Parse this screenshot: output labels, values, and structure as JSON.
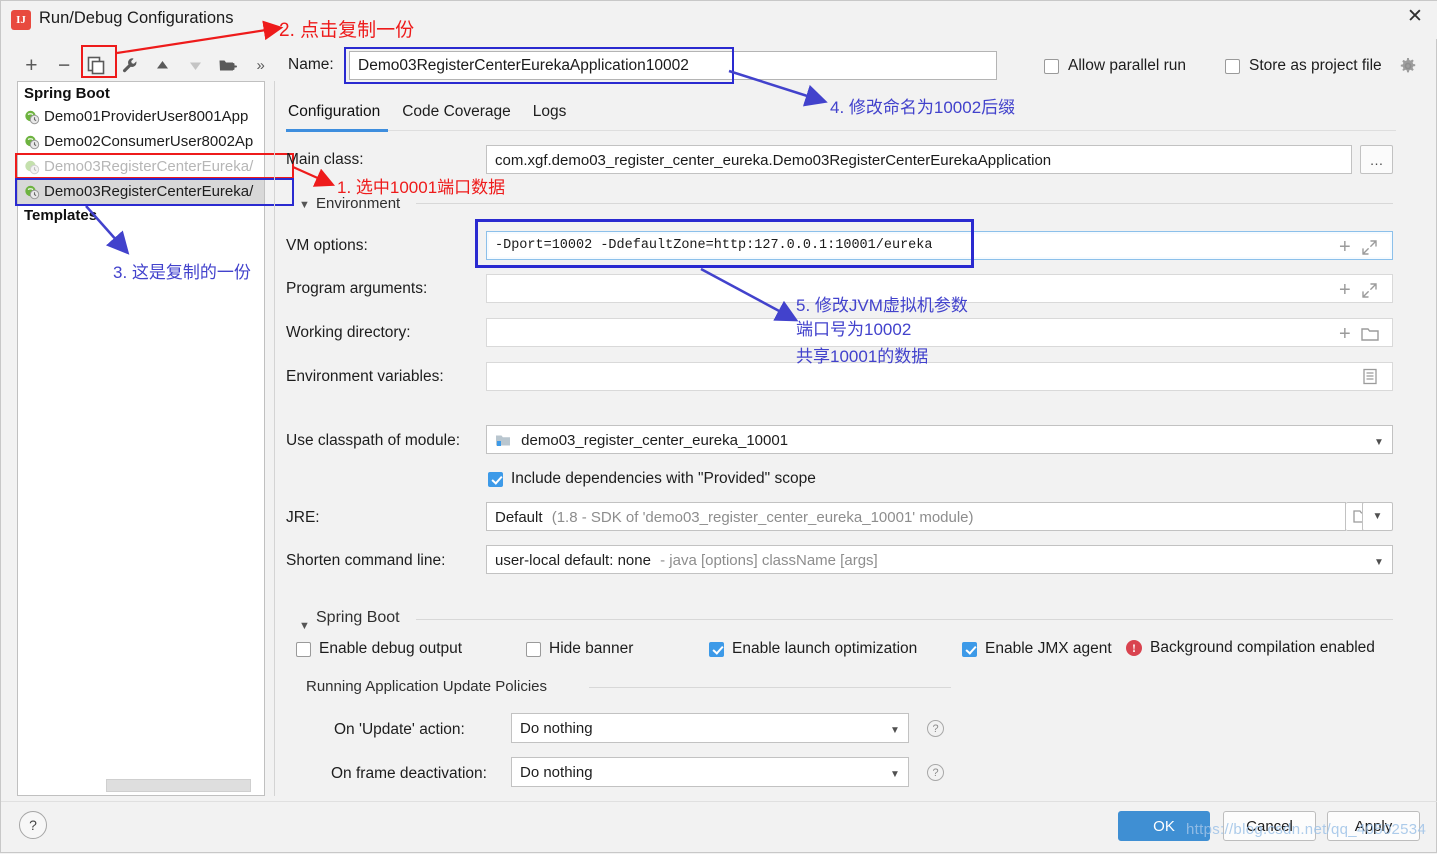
{
  "window": {
    "title": "Run/Debug Configurations",
    "icon": "intellij-idea-icon",
    "close_label": "✕"
  },
  "toolbar": {
    "add_label": "+",
    "remove_label": "−",
    "copy_label": "copy-configuration",
    "edit_templates_label": "edit-templates",
    "move_up_label": "▲",
    "move_down_label": "▼",
    "new_folder_label": "new-folder",
    "more_label": "»"
  },
  "tree": {
    "group_label": "Spring Boot",
    "templates_label": "Templates",
    "items": [
      {
        "label": "Demo01ProviderUser8001App",
        "state": "normal"
      },
      {
        "label": "Demo02ConsumerUser8002Ap",
        "state": "normal"
      },
      {
        "label": "Demo03RegisterCenterEureka/",
        "state": "dimmed"
      },
      {
        "label": "Demo03RegisterCenterEureka/",
        "state": "selected"
      }
    ]
  },
  "name": {
    "label": "Name:",
    "value": "Demo03RegisterCenterEurekaApplication10002"
  },
  "top_options": {
    "allow_parallel_run": {
      "label": "Allow parallel run",
      "checked": false
    },
    "store_as_project_file": {
      "label": "Store as project file",
      "checked": false
    },
    "gear_icon": "gear-icon"
  },
  "tabs": [
    {
      "label": "Configuration",
      "active": true
    },
    {
      "label": "Code Coverage",
      "active": false
    },
    {
      "label": "Logs",
      "active": false
    }
  ],
  "fields": {
    "main_class": {
      "label": "Main class:",
      "value": "com.xgf.demo03_register_center_eureka.Demo03RegisterCenterEurekaApplication",
      "browse_label": "…"
    },
    "environment_group": {
      "label": "Environment"
    },
    "vm_options": {
      "label": "VM options:",
      "value": "-Dport=10002 -DdefaultZone=http:127.0.0.1:10001/eureka"
    },
    "program_arguments": {
      "label": "Program arguments:",
      "value": ""
    },
    "working_directory": {
      "label": "Working directory:",
      "value": ""
    },
    "environment_variables": {
      "label": "Environment variables:",
      "value": ""
    },
    "use_classpath_of_module": {
      "label": "Use classpath of module:",
      "value": "demo03_register_center_eureka_10001"
    },
    "include_dependencies": {
      "label": "Include dependencies with \"Provided\" scope",
      "checked": true
    },
    "jre": {
      "label": "JRE:",
      "value": "Default",
      "value_sub": "(1.8 - SDK of 'demo03_register_center_eureka_10001' module)"
    },
    "shorten_command_line": {
      "label": "Shorten command line:",
      "value": "user-local default: none",
      "value_sub": "- java [options] className [args]"
    }
  },
  "spring_boot": {
    "group_label": "Spring Boot",
    "checkboxes": [
      {
        "label": "Enable debug output",
        "checked": false
      },
      {
        "label": "Hide banner",
        "checked": false
      },
      {
        "label": "Enable launch optimization",
        "checked": true
      },
      {
        "label": "Enable JMX agent",
        "checked": true
      }
    ],
    "warning": {
      "label": "Background compilation enabled",
      "icon": "error-icon"
    },
    "update_policies": {
      "group_label": "Running Application Update Policies",
      "on_update_action": {
        "label": "On 'Update' action:",
        "value": "Do nothing",
        "help": "?"
      },
      "on_frame_deactivation": {
        "label": "On frame deactivation:",
        "value": "Do nothing",
        "help": "?"
      }
    }
  },
  "footer": {
    "help_label": "?",
    "ok_label": "OK",
    "cancel_label": "Cancel",
    "apply_label": "Apply"
  },
  "annotations": [
    {
      "id": "a1",
      "text": "1. 选中10001端口数据",
      "color": "red"
    },
    {
      "id": "a2",
      "text": "2. 点击复制一份",
      "color": "red"
    },
    {
      "id": "a3",
      "text": "3. 这是复制的一份",
      "color": "blue"
    },
    {
      "id": "a4",
      "text": "4. 修改命名为10002后缀",
      "color": "blue"
    },
    {
      "id": "a5l1",
      "text": "5. 修改JVM虚拟机参数",
      "color": "blue"
    },
    {
      "id": "a5l2",
      "text": "端口号为10002",
      "color": "blue"
    },
    {
      "id": "a5l3",
      "text": "共享10001的数据",
      "color": "blue"
    }
  ],
  "watermark": {
    "text": "https://blog.csdn.net/qq_40502534"
  },
  "colors": {
    "accent": "#3e8ede",
    "annotation_red": "#ee1b1b",
    "annotation_blue": "#4242cc",
    "checkbox_checked": "#3d9ae8",
    "error": "#d9434f"
  }
}
